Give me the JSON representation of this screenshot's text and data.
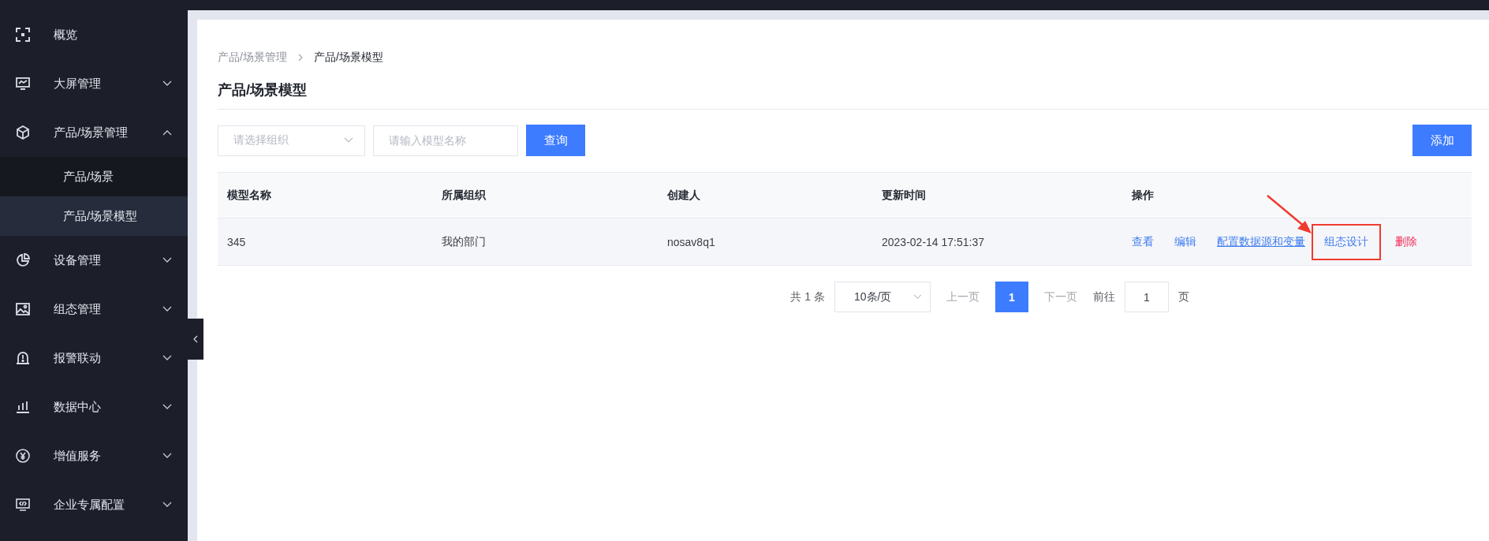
{
  "sidebar": {
    "items": [
      {
        "label": "概览"
      },
      {
        "label": "大屏管理",
        "expanded": false
      },
      {
        "label": "产品/场景管理",
        "expanded": true,
        "children": [
          {
            "label": "产品/场景",
            "selected": false
          },
          {
            "label": "产品/场景模型",
            "selected": true
          }
        ]
      },
      {
        "label": "设备管理",
        "expanded": false
      },
      {
        "label": "组态管理",
        "expanded": false
      },
      {
        "label": "报警联动",
        "expanded": false
      },
      {
        "label": "数据中心",
        "expanded": false
      },
      {
        "label": "增值服务",
        "expanded": false
      },
      {
        "label": "企业专属配置",
        "expanded": false
      }
    ]
  },
  "breadcrumb": [
    "产品/场景管理",
    "产品/场景模型"
  ],
  "page_title": "产品/场景模型",
  "filters": {
    "organization_select": {
      "placeholder": "请选择组织"
    },
    "name_field": {
      "placeholder": "请输入模型名称"
    },
    "query_button": "查询",
    "add_button": "添加"
  },
  "table": {
    "columns": [
      "模型名称",
      "所属组织",
      "创建人",
      "更新时间",
      "操作"
    ],
    "rows": [
      {
        "cells": [
          "345",
          "我的部门",
          "nosav8q1",
          "2023-02-14 17:51:37"
        ],
        "actions": [
          {
            "label": "查看",
            "kind": "normal",
            "underlined": false,
            "highlighted": false
          },
          {
            "label": "编辑",
            "kind": "normal",
            "underlined": false,
            "highlighted": false
          },
          {
            "label": "配置数据源和变量",
            "kind": "normal",
            "underlined": true,
            "highlighted": false
          },
          {
            "label": "组态设计",
            "kind": "normal",
            "underlined": false,
            "highlighted": true
          },
          {
            "label": "删除",
            "kind": "danger",
            "underlined": false,
            "highlighted": false
          }
        ]
      }
    ]
  },
  "pagination": {
    "total": "共 1 条",
    "page_size": "10条/页",
    "prev": "上一页",
    "pages": [
      {
        "label": "1",
        "selected": true
      }
    ],
    "next": "下一页",
    "goto_label": "前往",
    "goto_value": "1",
    "goto_suffix": "页"
  }
}
